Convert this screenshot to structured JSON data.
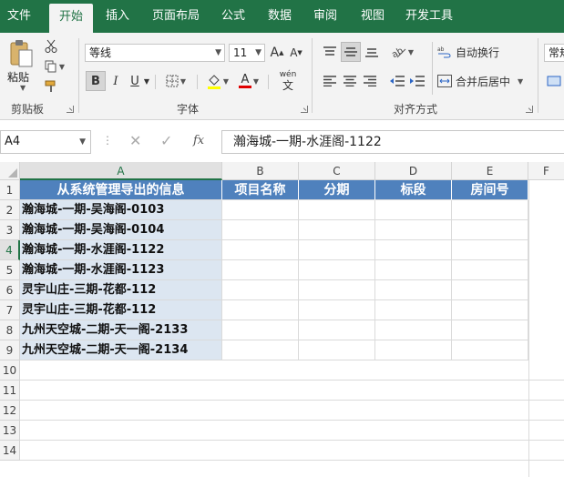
{
  "tabs": [
    "文件",
    "开始",
    "插入",
    "页面布局",
    "公式",
    "数据",
    "审阅",
    "视图",
    "开发工具"
  ],
  "ribbon": {
    "clipboard": {
      "label": "剪贴板",
      "paste": "粘贴"
    },
    "font": {
      "label": "字体",
      "name": "等线",
      "size": "11",
      "bold": "B",
      "italic": "I",
      "underline": "U",
      "wen": "wén",
      "wen_char": "文"
    },
    "align": {
      "label": "对齐方式",
      "wrap": "自动换行",
      "merge": "合并后居中"
    },
    "number": {
      "format": "常规"
    }
  },
  "formula_bar": {
    "name_box": "A4",
    "fx": "fx",
    "formula": "瀚海城-一期-水涯阁-1122"
  },
  "columns": [
    "A",
    "B",
    "C",
    "D",
    "E",
    "F"
  ],
  "rows": [
    "1",
    "2",
    "3",
    "4",
    "5",
    "6",
    "7",
    "8",
    "9",
    "10",
    "11",
    "12",
    "13",
    "14"
  ],
  "table": {
    "headers": [
      "从系统管理导出的信息",
      "项目名称",
      "分期",
      "标段",
      "房间号"
    ],
    "data": [
      "瀚海城-一期-吴海阁-0103",
      "瀚海城-一期-吴海阁-0104",
      "瀚海城-一期-水涯阁-1122",
      "瀚海城-一期-水涯阁-1123",
      "灵宇山庄-三期-花都-112",
      "灵宇山庄-三期-花都-112",
      "九州天空城-二期-天一阁-2133",
      "九州天空城-二期-天一阁-2134"
    ]
  },
  "colors": {
    "brand": "#217346",
    "header_fill": "#4f81bd",
    "data_fill": "#dce6f1"
  }
}
